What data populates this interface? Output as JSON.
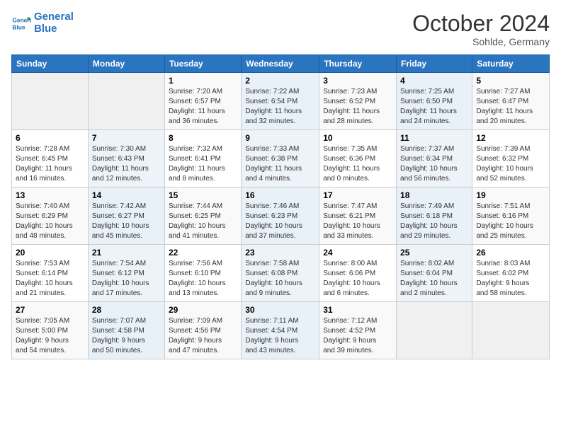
{
  "header": {
    "logo_line1": "General",
    "logo_line2": "Blue",
    "month": "October 2024",
    "location": "Sohlde, Germany"
  },
  "days_of_week": [
    "Sunday",
    "Monday",
    "Tuesday",
    "Wednesday",
    "Thursday",
    "Friday",
    "Saturday"
  ],
  "weeks": [
    [
      {
        "num": "",
        "content": ""
      },
      {
        "num": "",
        "content": ""
      },
      {
        "num": "1",
        "content": "Sunrise: 7:20 AM\nSunset: 6:57 PM\nDaylight: 11 hours\nand 36 minutes."
      },
      {
        "num": "2",
        "content": "Sunrise: 7:22 AM\nSunset: 6:54 PM\nDaylight: 11 hours\nand 32 minutes."
      },
      {
        "num": "3",
        "content": "Sunrise: 7:23 AM\nSunset: 6:52 PM\nDaylight: 11 hours\nand 28 minutes."
      },
      {
        "num": "4",
        "content": "Sunrise: 7:25 AM\nSunset: 6:50 PM\nDaylight: 11 hours\nand 24 minutes."
      },
      {
        "num": "5",
        "content": "Sunrise: 7:27 AM\nSunset: 6:47 PM\nDaylight: 11 hours\nand 20 minutes."
      }
    ],
    [
      {
        "num": "6",
        "content": "Sunrise: 7:28 AM\nSunset: 6:45 PM\nDaylight: 11 hours\nand 16 minutes."
      },
      {
        "num": "7",
        "content": "Sunrise: 7:30 AM\nSunset: 6:43 PM\nDaylight: 11 hours\nand 12 minutes."
      },
      {
        "num": "8",
        "content": "Sunrise: 7:32 AM\nSunset: 6:41 PM\nDaylight: 11 hours\nand 8 minutes."
      },
      {
        "num": "9",
        "content": "Sunrise: 7:33 AM\nSunset: 6:38 PM\nDaylight: 11 hours\nand 4 minutes."
      },
      {
        "num": "10",
        "content": "Sunrise: 7:35 AM\nSunset: 6:36 PM\nDaylight: 11 hours\nand 0 minutes."
      },
      {
        "num": "11",
        "content": "Sunrise: 7:37 AM\nSunset: 6:34 PM\nDaylight: 10 hours\nand 56 minutes."
      },
      {
        "num": "12",
        "content": "Sunrise: 7:39 AM\nSunset: 6:32 PM\nDaylight: 10 hours\nand 52 minutes."
      }
    ],
    [
      {
        "num": "13",
        "content": "Sunrise: 7:40 AM\nSunset: 6:29 PM\nDaylight: 10 hours\nand 48 minutes."
      },
      {
        "num": "14",
        "content": "Sunrise: 7:42 AM\nSunset: 6:27 PM\nDaylight: 10 hours\nand 45 minutes."
      },
      {
        "num": "15",
        "content": "Sunrise: 7:44 AM\nSunset: 6:25 PM\nDaylight: 10 hours\nand 41 minutes."
      },
      {
        "num": "16",
        "content": "Sunrise: 7:46 AM\nSunset: 6:23 PM\nDaylight: 10 hours\nand 37 minutes."
      },
      {
        "num": "17",
        "content": "Sunrise: 7:47 AM\nSunset: 6:21 PM\nDaylight: 10 hours\nand 33 minutes."
      },
      {
        "num": "18",
        "content": "Sunrise: 7:49 AM\nSunset: 6:18 PM\nDaylight: 10 hours\nand 29 minutes."
      },
      {
        "num": "19",
        "content": "Sunrise: 7:51 AM\nSunset: 6:16 PM\nDaylight: 10 hours\nand 25 minutes."
      }
    ],
    [
      {
        "num": "20",
        "content": "Sunrise: 7:53 AM\nSunset: 6:14 PM\nDaylight: 10 hours\nand 21 minutes."
      },
      {
        "num": "21",
        "content": "Sunrise: 7:54 AM\nSunset: 6:12 PM\nDaylight: 10 hours\nand 17 minutes."
      },
      {
        "num": "22",
        "content": "Sunrise: 7:56 AM\nSunset: 6:10 PM\nDaylight: 10 hours\nand 13 minutes."
      },
      {
        "num": "23",
        "content": "Sunrise: 7:58 AM\nSunset: 6:08 PM\nDaylight: 10 hours\nand 9 minutes."
      },
      {
        "num": "24",
        "content": "Sunrise: 8:00 AM\nSunset: 6:06 PM\nDaylight: 10 hours\nand 6 minutes."
      },
      {
        "num": "25",
        "content": "Sunrise: 8:02 AM\nSunset: 6:04 PM\nDaylight: 10 hours\nand 2 minutes."
      },
      {
        "num": "26",
        "content": "Sunrise: 8:03 AM\nSunset: 6:02 PM\nDaylight: 9 hours\nand 58 minutes."
      }
    ],
    [
      {
        "num": "27",
        "content": "Sunrise: 7:05 AM\nSunset: 5:00 PM\nDaylight: 9 hours\nand 54 minutes."
      },
      {
        "num": "28",
        "content": "Sunrise: 7:07 AM\nSunset: 4:58 PM\nDaylight: 9 hours\nand 50 minutes."
      },
      {
        "num": "29",
        "content": "Sunrise: 7:09 AM\nSunset: 4:56 PM\nDaylight: 9 hours\nand 47 minutes."
      },
      {
        "num": "30",
        "content": "Sunrise: 7:11 AM\nSunset: 4:54 PM\nDaylight: 9 hours\nand 43 minutes."
      },
      {
        "num": "31",
        "content": "Sunrise: 7:12 AM\nSunset: 4:52 PM\nDaylight: 9 hours\nand 39 minutes."
      },
      {
        "num": "",
        "content": ""
      },
      {
        "num": "",
        "content": ""
      }
    ]
  ]
}
